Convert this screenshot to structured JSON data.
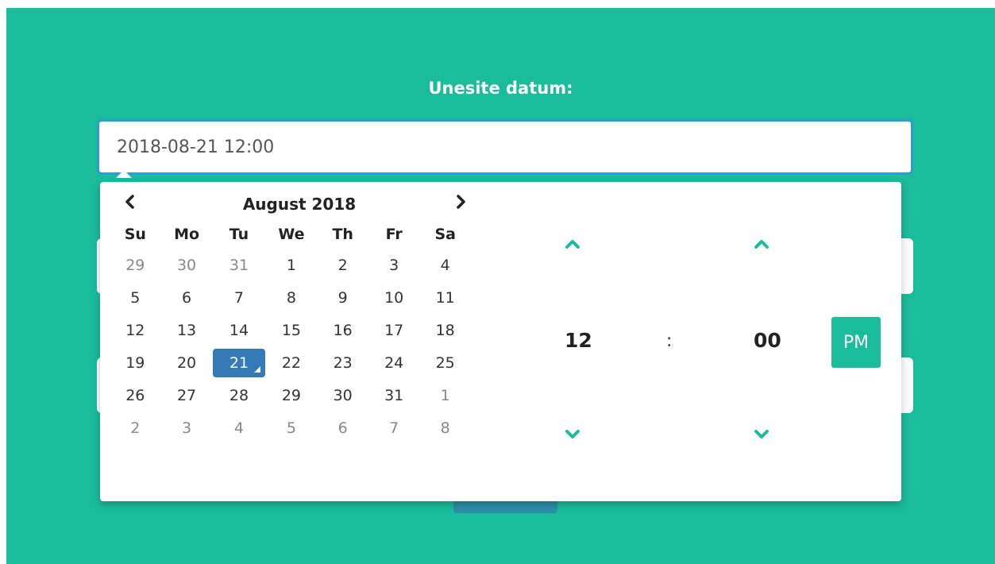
{
  "page": {
    "label": "Unesite datum:"
  },
  "date_input": {
    "value": "2018-08-21 12:00"
  },
  "calendar": {
    "month_label": "August 2018",
    "weekdays": [
      "Su",
      "Mo",
      "Tu",
      "We",
      "Th",
      "Fr",
      "Sa"
    ],
    "weeks": [
      [
        "29",
        "30",
        "31",
        "1",
        "2",
        "3",
        "4"
      ],
      [
        "5",
        "6",
        "7",
        "8",
        "9",
        "10",
        "11"
      ],
      [
        "12",
        "13",
        "14",
        "15",
        "16",
        "17",
        "18"
      ],
      [
        "19",
        "20",
        "21",
        "22",
        "23",
        "24",
        "25"
      ],
      [
        "26",
        "27",
        "28",
        "29",
        "30",
        "31",
        "1"
      ],
      [
        "2",
        "3",
        "4",
        "5",
        "6",
        "7",
        "8"
      ]
    ],
    "selected_day": "21",
    "prev_icon": "chevron-left-icon",
    "next_icon": "chevron-right-icon"
  },
  "time": {
    "hour": "12",
    "separator": ":",
    "minute": "00",
    "period": "PM",
    "up_icon": "chevron-up-icon",
    "down_icon": "chevron-down-icon"
  },
  "colors": {
    "background": "#1abc9c",
    "accent": "#1abc9c",
    "selected": "#337ab7",
    "input_border": "#2a9fd6"
  }
}
